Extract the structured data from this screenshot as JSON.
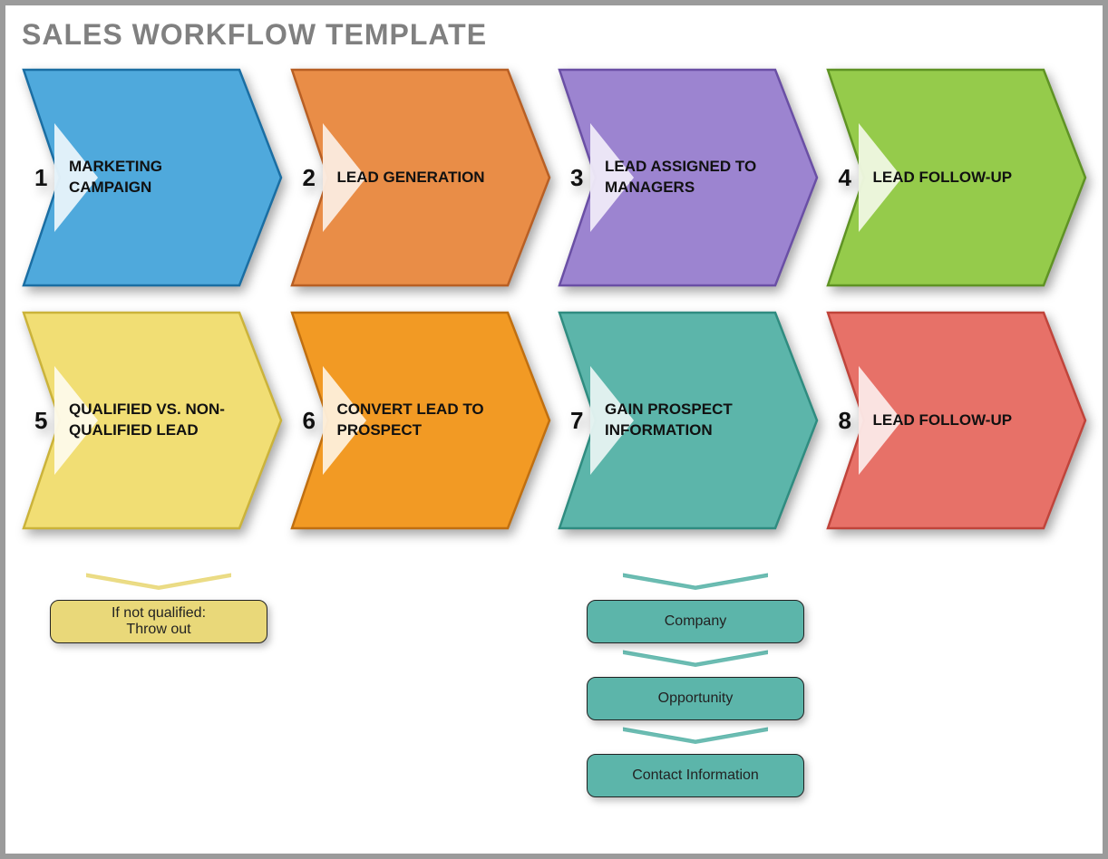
{
  "title": "SALES WORKFLOW TEMPLATE",
  "steps": [
    {
      "num": "1",
      "label": "MARKETING CAMPAIGN",
      "fill": "#4fa9dc",
      "stroke": "#1a6ea3",
      "notch": "#b7dcf1"
    },
    {
      "num": "2",
      "label": "LEAD GENERATION",
      "fill": "#e98d47",
      "stroke": "#b85f24",
      "notch": "#f3c6a3"
    },
    {
      "num": "3",
      "label": "LEAD ASSIGNED TO MANAGERS",
      "fill": "#9c84d0",
      "stroke": "#6a4fa5",
      "notch": "#cfc1e9"
    },
    {
      "num": "4",
      "label": "LEAD FOLLOW-UP",
      "fill": "#95cb4b",
      "stroke": "#5f9324",
      "notch": "#cde6a6"
    },
    {
      "num": "5",
      "label": "QUALIFIED VS. NON-QUALIFIED LEAD",
      "fill": "#f1de74",
      "stroke": "#cbb33a",
      "notch": "#faf1c0"
    },
    {
      "num": "6",
      "label": "CONVERT LEAD TO PROSPECT",
      "fill": "#f29a24",
      "stroke": "#c06f10",
      "notch": "#f9cf93"
    },
    {
      "num": "7",
      "label": "GAIN PROSPECT INFORMATION",
      "fill": "#5cb5aa",
      "stroke": "#2f8c80",
      "notch": "#b1ddd7"
    },
    {
      "num": "8",
      "label": "LEAD FOLLOW-UP",
      "fill": "#e77168",
      "stroke": "#c0443b",
      "notch": "#f4bcb7"
    }
  ],
  "sub_qualified": {
    "pill_fill": "#e9d879",
    "chev_fill": "#e9d879",
    "items": [
      "If not qualified:\nThrow out"
    ]
  },
  "sub_prospect": {
    "pill_fill": "#5cb5aa",
    "chev_fill": "#5cb5aa",
    "items": [
      "Company",
      "Opportunity",
      "Contact Information"
    ]
  }
}
